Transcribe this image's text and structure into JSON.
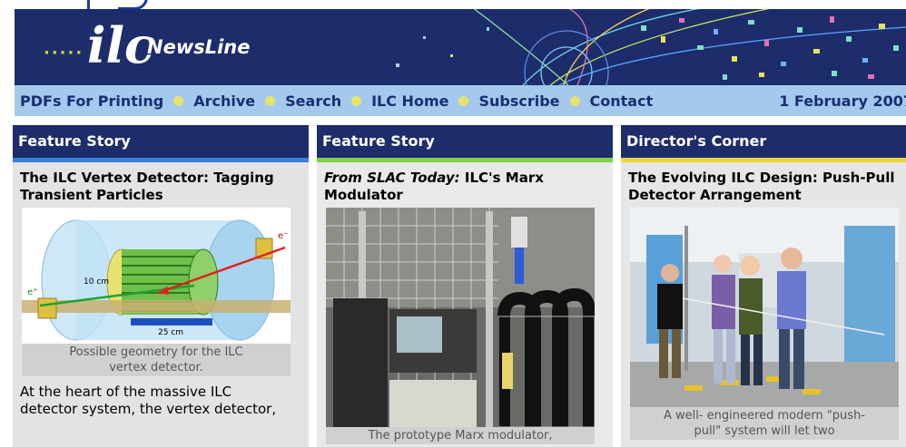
{
  "banner": {
    "logo_dots": "·····",
    "logo_mark": "ilc",
    "logo_name": "NewsLine"
  },
  "nav": {
    "items": [
      {
        "label": "PDFs For Printing"
      },
      {
        "label": "Archive"
      },
      {
        "label": "Search"
      },
      {
        "label": "ILC Home"
      },
      {
        "label": "Subscribe"
      },
      {
        "label": "Contact"
      }
    ],
    "date": "1 February 2007"
  },
  "columns": [
    {
      "header": "Feature Story",
      "title": "The ILC Vertex Detector: Tagging Transient Particles",
      "caption_line1": "Possible geometry for the ILC",
      "caption_line2": "vertex detector.",
      "figure_labels": {
        "e_minus": "e⁻",
        "e_plus": "e⁺",
        "dim1": "10 cm",
        "dim2": "25 cm"
      },
      "body_line1": "At the heart of the massive ILC",
      "body_line2": "detector system, the vertex detector,"
    },
    {
      "header": "Feature Story",
      "title_source": "From SLAC Today:",
      "title_rest": " ILC's Marx Modulator",
      "caption_line1": "The prototype Marx modulator,"
    },
    {
      "header": "Director's Corner",
      "title": "The Evolving ILC Design: Push-Pull Detector Arrangement",
      "caption_line1": "A well- engineered modern \"push-",
      "caption_line2": "pull\" system will let two"
    }
  ],
  "colors": {
    "banner_bg": "#1d2c6b",
    "nav_bg": "#a4c9ec",
    "nav_text": "#1b2d73",
    "accent_blue": "#3b7dd8",
    "accent_green": "#7ed146",
    "accent_yellow": "#e8d63a"
  }
}
